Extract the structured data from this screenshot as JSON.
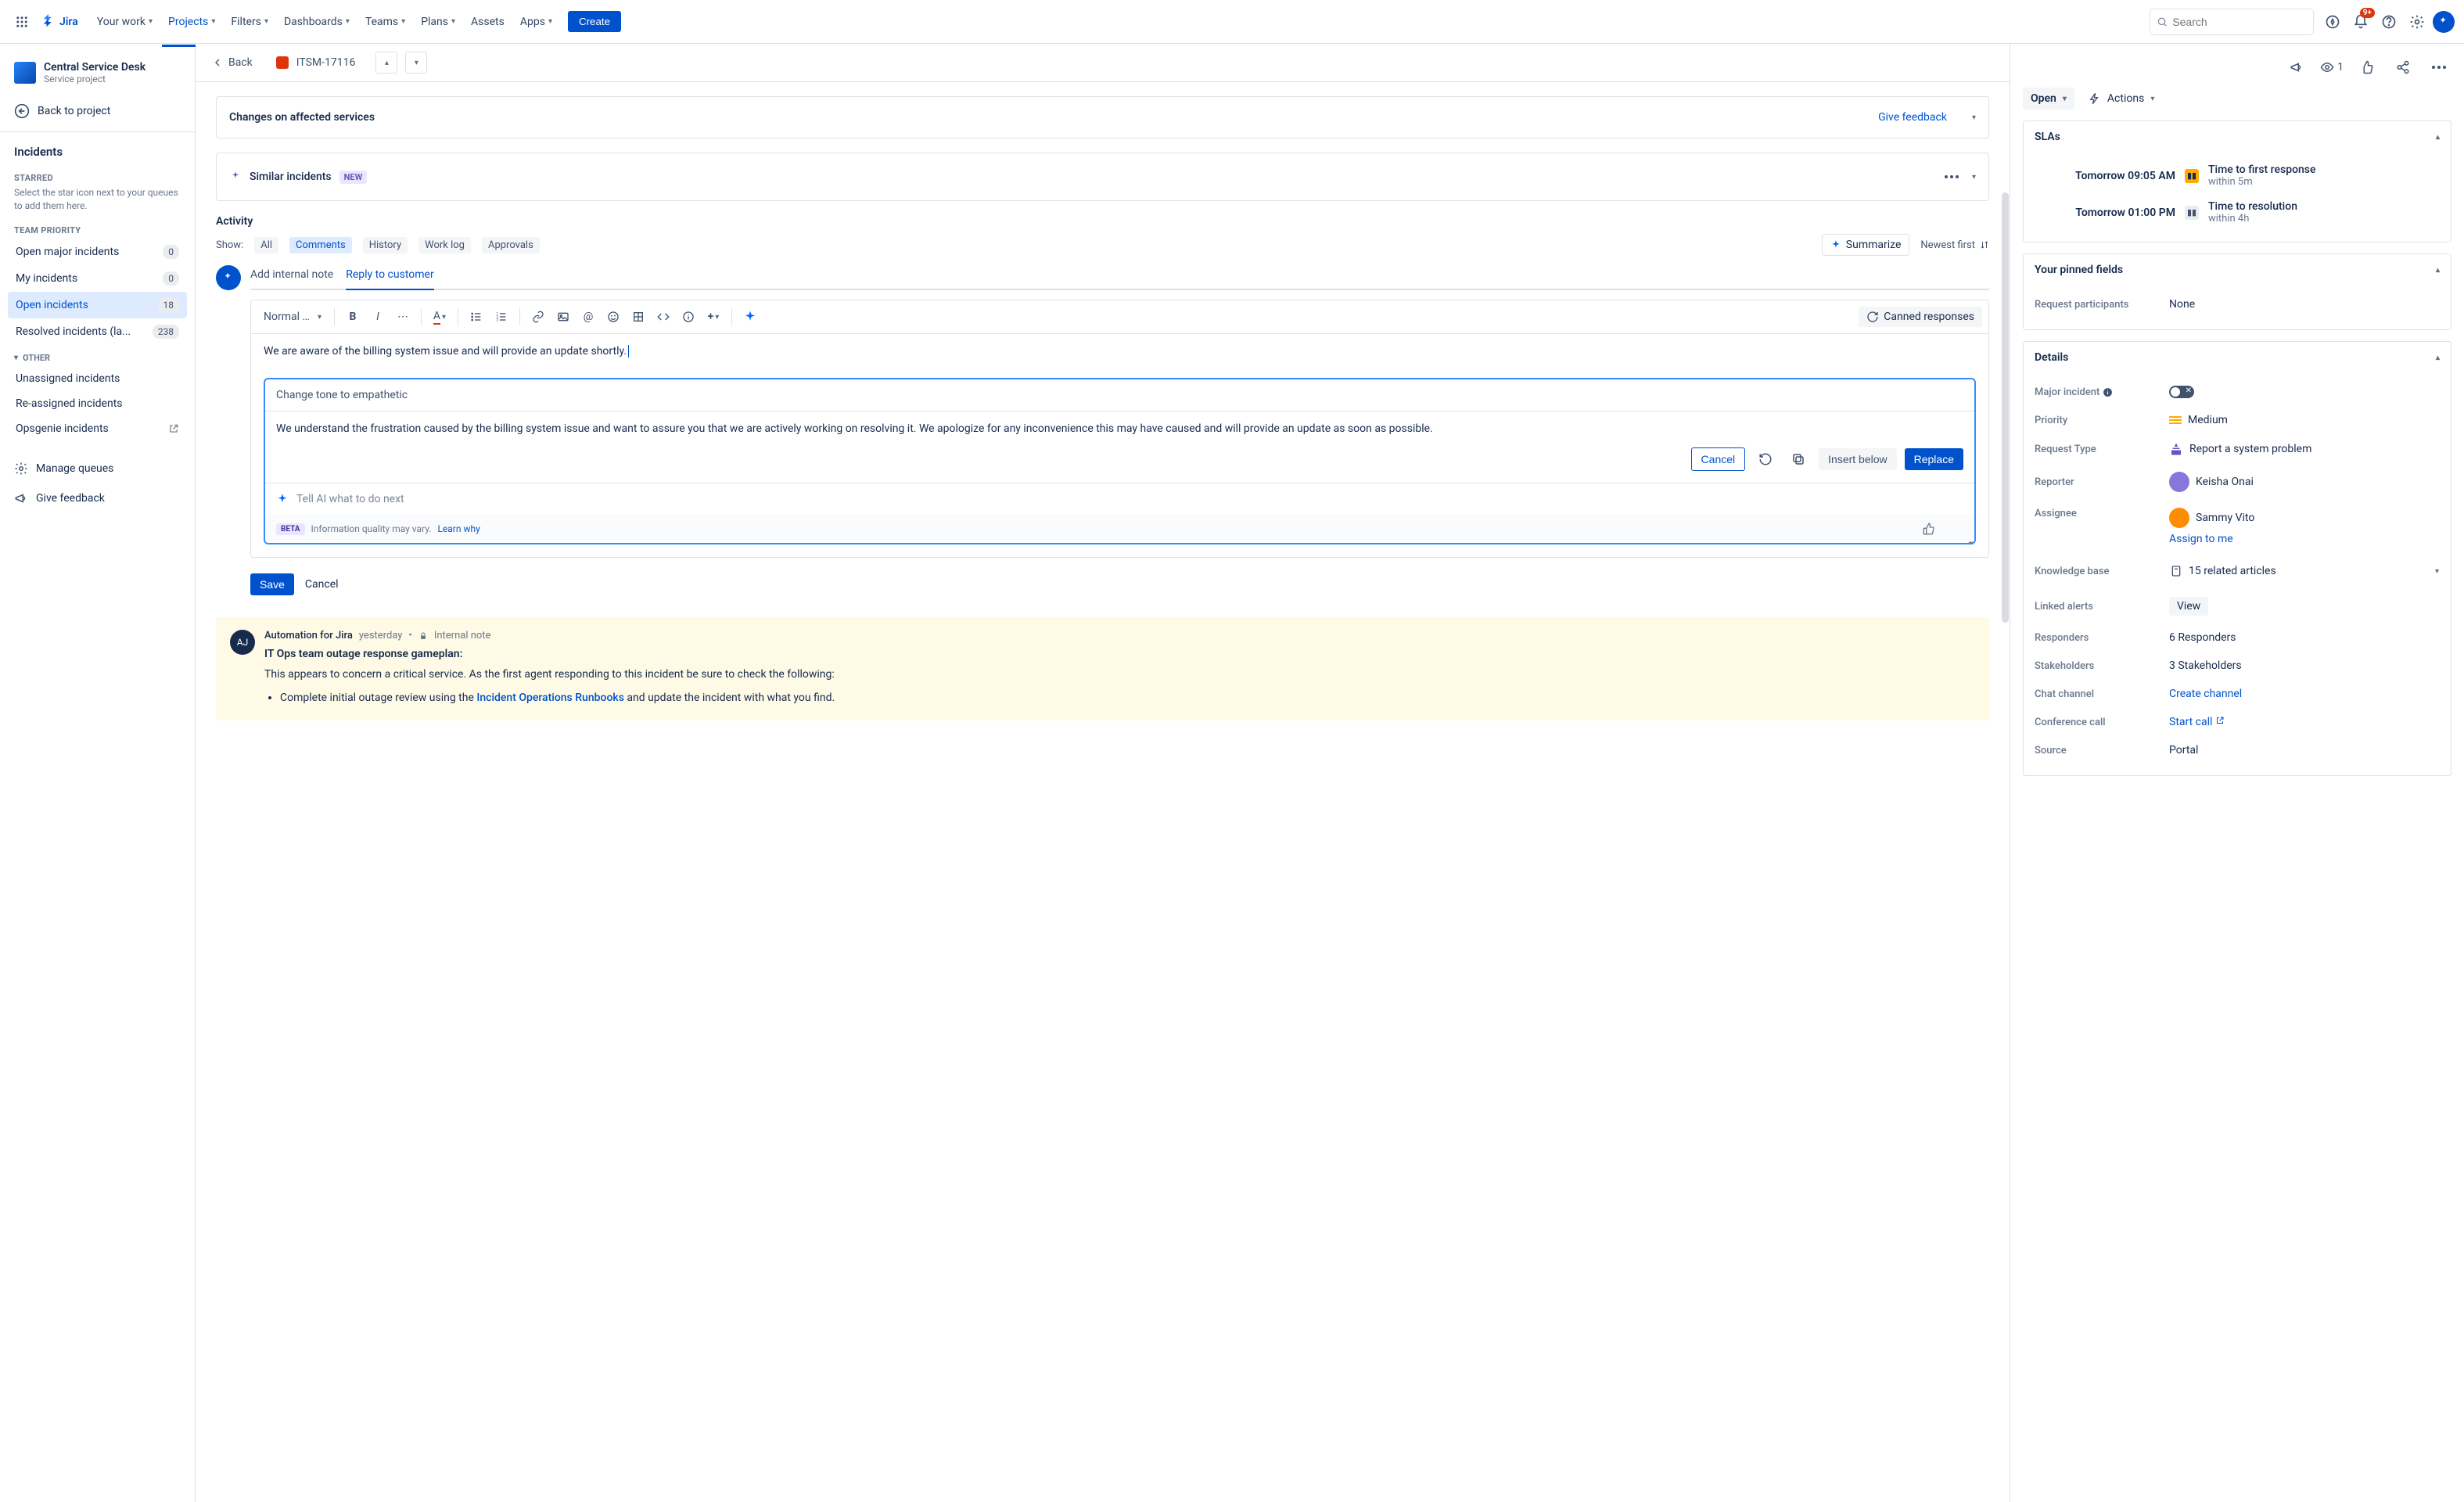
{
  "topnav": {
    "logo": "Jira",
    "items": [
      "Your work",
      "Projects",
      "Filters",
      "Dashboards",
      "Teams",
      "Plans",
      "Assets",
      "Apps"
    ],
    "active_index": 1,
    "create": "Create",
    "search_placeholder": "Search",
    "notif_badge": "9+"
  },
  "sidebar": {
    "project_name": "Central Service Desk",
    "project_sub": "Service project",
    "back": "Back to project",
    "heading": "Incidents",
    "starred_label": "STARRED",
    "starred_hint": "Select the star icon next to your queues to add them here.",
    "team_label": "TEAM PRIORITY",
    "queues": [
      {
        "label": "Open major incidents",
        "count": "0"
      },
      {
        "label": "My incidents",
        "count": "0"
      },
      {
        "label": "Open incidents",
        "count": "18",
        "selected": true
      },
      {
        "label": "Resolved incidents (la...",
        "count": "238"
      }
    ],
    "other_label": "OTHER",
    "other": [
      {
        "label": "Unassigned incidents"
      },
      {
        "label": "Re-assigned incidents"
      },
      {
        "label": "Opsgenie incidents",
        "external": true
      }
    ],
    "manage": "Manage queues",
    "feedback": "Give feedback"
  },
  "issue": {
    "back": "Back",
    "key": "ITSM-17116",
    "affected_title": "Changes on affected services",
    "give_feedback": "Give feedback",
    "similar_title": "Similar incidents",
    "new_label": "NEW"
  },
  "activity": {
    "heading": "Activity",
    "show_label": "Show:",
    "filters": [
      "All",
      "Comments",
      "History",
      "Work log",
      "Approvals"
    ],
    "active_filter": 1,
    "summarize": "Summarize",
    "sort": "Newest first"
  },
  "editor": {
    "tabs": [
      "Add internal note",
      "Reply to customer"
    ],
    "active_tab": 1,
    "text_style": "Normal text",
    "canned": "Canned responses",
    "typed": "We are aware of the billing system issue and will provide an update shortly.",
    "ai_prompt": "Change tone to empathetic",
    "ai_suggestion": "We understand the frustration caused by the billing system issue and want to assure you that we are actively working on resolving it. We apologize for any inconvenience this may have caused and will provide an update as soon as possible.",
    "cancel": "Cancel",
    "insert": "Insert below",
    "replace": "Replace",
    "ai_placeholder": "Tell AI what to do next",
    "beta": "BETA",
    "disclaimer": "Information quality may vary.",
    "learn": "Learn why",
    "save": "Save",
    "cancel2": "Cancel"
  },
  "comment": {
    "avatar": "AJ",
    "author": "Automation for Jira",
    "time": "yesterday",
    "note_label": "Internal note",
    "title": "IT Ops team outage response gameplan:",
    "body": "This appears to concern a critical service. As the first agent responding to this incident be sure to check the following:",
    "bullet_pre": "Complete initial outage review using the ",
    "bullet_link": "Incident Operations Runbooks",
    "bullet_post": " and update the incident with what you find."
  },
  "right": {
    "watch_count": "1",
    "status": "Open",
    "actions": "Actions",
    "slas_h": "SLAs",
    "slas": [
      {
        "time": "Tomorrow 09:05 AM",
        "state": "paused",
        "label": "Time to first response",
        "sub": "within 5m"
      },
      {
        "time": "Tomorrow 01:00 PM",
        "state": "idle",
        "label": "Time to resolution",
        "sub": "within 4h"
      }
    ],
    "pinned_h": "Your pinned fields",
    "req_participants_label": "Request participants",
    "req_participants_val": "None",
    "details_h": "Details",
    "major_label": "Major incident",
    "priority_label": "Priority",
    "priority_val": "Medium",
    "reqtype_label": "Request Type",
    "reqtype_val": "Report a system problem",
    "reporter_label": "Reporter",
    "reporter_val": "Keisha Onai",
    "assignee_label": "Assignee",
    "assignee_val": "Sammy Vito",
    "assign_me": "Assign to me",
    "kb_label": "Knowledge base",
    "kb_val": "15 related articles",
    "alerts_label": "Linked alerts",
    "alerts_val": "View",
    "responders_label": "Responders",
    "responders_val": "6 Responders",
    "stake_label": "Stakeholders",
    "stake_val": "3 Stakeholders",
    "chat_label": "Chat channel",
    "chat_val": "Create channel",
    "conf_label": "Conference call",
    "conf_val": "Start call",
    "source_label": "Source",
    "source_val": "Portal"
  }
}
